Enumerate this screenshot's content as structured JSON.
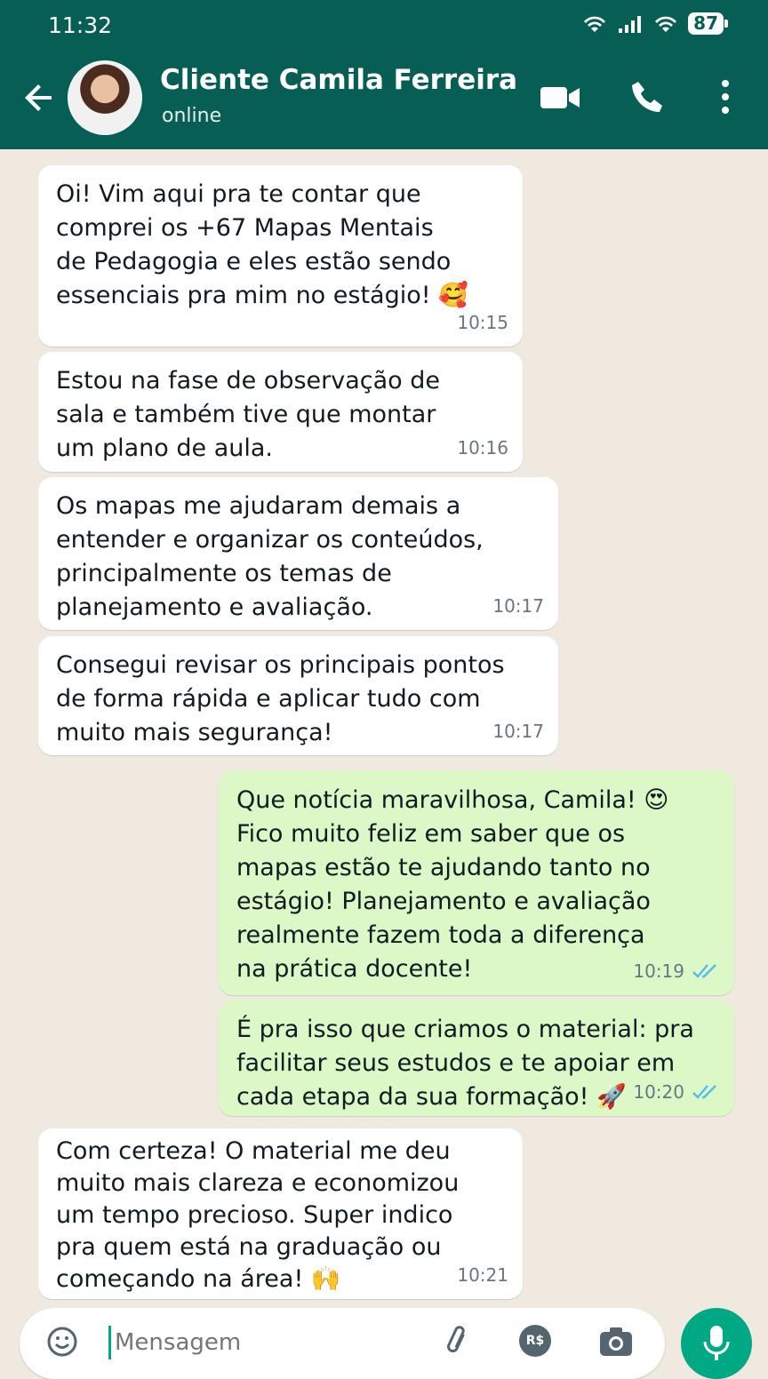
{
  "status_bar": {
    "time": "11:32",
    "battery": "87"
  },
  "header": {
    "contact_name": "Cliente Camila Ferreira",
    "contact_status": "online"
  },
  "messages": [
    {
      "direction": "incoming",
      "text": "Oi! Vim aqui pra te contar que\ncomprei os +67 Mapas Mentais\nde Pedagogia e eles estão sendo\nessenciais pra mim no estágio! 🥰",
      "time": "10:15"
    },
    {
      "direction": "incoming",
      "text": "Estou na fase de observação de\nsala e também tive que montar\num plano de aula.",
      "time": "10:16"
    },
    {
      "direction": "incoming",
      "text": "Os mapas me ajudaram demais a\nentender e organizar os conteúdos,\nprincipalmente os temas de\nplanejamento e avaliação.",
      "time": "10:17"
    },
    {
      "direction": "incoming",
      "text": "Consegui revisar os principais pontos\nde forma rápida e aplicar tudo com\nmuito mais segurança!",
      "time": "10:17"
    },
    {
      "direction": "outgoing",
      "text": "Que notícia maravilhosa, Camila! 😍\nFico muito feliz em saber que os\nmapas estão te ajudando tanto no\nestágio! Planejamento e avaliação\nrealmente fazem toda a diferença\nna prática docente!",
      "time": "10:19",
      "status": "read"
    },
    {
      "direction": "outgoing",
      "text": "É pra isso que criamos o material: pra\nfacilitar seus estudos e te apoiar em\ncada etapa da sua formação! 🚀",
      "time": "10:20",
      "status": "read"
    },
    {
      "direction": "incoming",
      "text": "Com certeza! O material me deu\nmuito mais clareza e economizou\num tempo precioso. Super indico\npra quem está na graduação ou\ncomeçando na área! 🙌",
      "time": "10:21"
    }
  ],
  "composer": {
    "placeholder": "Mensagem"
  },
  "icons": {
    "back": "arrow-left-icon",
    "video": "video-camera-icon",
    "call": "phone-icon",
    "menu": "more-vert-icon",
    "emoji": "emoji-icon",
    "attach": "paperclip-icon",
    "payment": "rs-payment-icon",
    "camera": "camera-icon",
    "mic": "mic-icon"
  },
  "colors": {
    "header": "#075e54",
    "outgoing_bubble": "#dcf8c6",
    "accent": "#00a884",
    "read_ticks": "#53bdeb"
  }
}
